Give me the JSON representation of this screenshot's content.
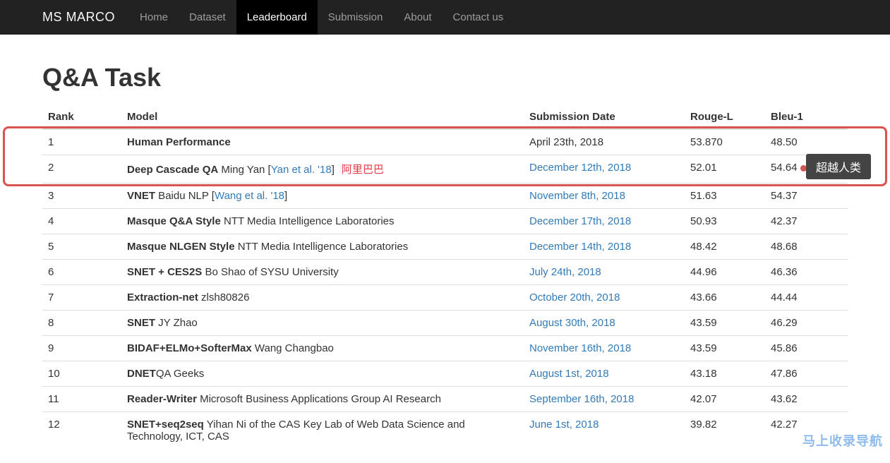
{
  "nav": {
    "brand": "MS MARCO",
    "items": [
      {
        "label": "Home",
        "active": false
      },
      {
        "label": "Dataset",
        "active": false
      },
      {
        "label": "Leaderboard",
        "active": true
      },
      {
        "label": "Submission",
        "active": false
      },
      {
        "label": "About",
        "active": false
      },
      {
        "label": "Contact us",
        "active": false
      }
    ]
  },
  "page": {
    "title": "Q&A Task"
  },
  "table": {
    "headers": {
      "rank": "Rank",
      "model": "Model",
      "date": "Submission Date",
      "rouge": "Rouge-L",
      "bleu": "Bleu-1"
    },
    "rows": [
      {
        "rank": "1",
        "model_strong": "Human Performance",
        "model_rest": "",
        "citation": "",
        "org_red": "",
        "date": "April 23th, 2018",
        "date_is_link": false,
        "rouge": "53.870",
        "bleu": "48.50",
        "bleu_dot": false
      },
      {
        "rank": "2",
        "model_strong": "Deep Cascade QA",
        "model_rest": " Ming Yan [",
        "citation": "Yan et al. '18",
        "citation_close": "]",
        "org_red": "阿里巴巴",
        "date": "December 12th, 2018",
        "date_is_link": true,
        "rouge": "52.01",
        "bleu": "54.64",
        "bleu_dot": true
      },
      {
        "rank": "3",
        "model_strong": "VNET",
        "model_rest": " Baidu NLP [",
        "citation": "Wang et al. '18",
        "citation_close": "]",
        "org_red": "",
        "date": "November 8th, 2018",
        "date_is_link": true,
        "rouge": "51.63",
        "bleu": "54.37",
        "bleu_dot": false
      },
      {
        "rank": "4",
        "model_strong": "Masque Q&A Style",
        "model_rest": " NTT Media Intelligence Laboratories",
        "citation": "",
        "org_red": "",
        "date": "December 17th, 2018",
        "date_is_link": true,
        "rouge": "50.93",
        "bleu": "42.37",
        "bleu_dot": false
      },
      {
        "rank": "5",
        "model_strong": "Masque NLGEN Style",
        "model_rest": " NTT Media Intelligence Laboratories",
        "citation": "",
        "org_red": "",
        "date": "December 14th, 2018",
        "date_is_link": true,
        "rouge": "48.42",
        "bleu": "48.68",
        "bleu_dot": false
      },
      {
        "rank": "6",
        "model_strong": "SNET + CES2S",
        "model_rest": " Bo Shao of SYSU University",
        "citation": "",
        "org_red": "",
        "date": "July 24th, 2018",
        "date_is_link": true,
        "rouge": "44.96",
        "bleu": "46.36",
        "bleu_dot": false
      },
      {
        "rank": "7",
        "model_strong": "Extraction-net",
        "model_rest": " zlsh80826",
        "citation": "",
        "org_red": "",
        "date": "October 20th, 2018",
        "date_is_link": true,
        "rouge": "43.66",
        "bleu": "44.44",
        "bleu_dot": false
      },
      {
        "rank": "8",
        "model_strong": "SNET",
        "model_rest": " JY Zhao",
        "citation": "",
        "org_red": "",
        "date": "August 30th, 2018",
        "date_is_link": true,
        "rouge": "43.59",
        "bleu": "46.29",
        "bleu_dot": false
      },
      {
        "rank": "9",
        "model_strong": "BIDAF+ELMo+SofterMax",
        "model_rest": " Wang Changbao",
        "citation": "",
        "org_red": "",
        "date": "November 16th, 2018",
        "date_is_link": true,
        "rouge": "43.59",
        "bleu": "45.86",
        "bleu_dot": false
      },
      {
        "rank": "10",
        "model_strong": "DNET",
        "model_rest": "QA Geeks",
        "citation": "",
        "org_red": "",
        "date": "August 1st, 2018",
        "date_is_link": true,
        "rouge": "43.18",
        "bleu": "47.86",
        "bleu_dot": false
      },
      {
        "rank": "11",
        "model_strong": "Reader-Writer",
        "model_rest": " Microsoft Business Applications Group AI Research",
        "citation": "",
        "org_red": "",
        "date": "September 16th, 2018",
        "date_is_link": true,
        "rouge": "42.07",
        "bleu": "43.62",
        "bleu_dot": false
      },
      {
        "rank": "12",
        "model_strong": "SNET+seq2seq",
        "model_rest": " Yihan Ni of the CAS Key Lab of Web Data Science and Technology, ICT, CAS",
        "citation": "",
        "org_red": "",
        "date": "June 1st, 2018",
        "date_is_link": true,
        "rouge": "39.82",
        "bleu": "42.27",
        "bleu_dot": false
      }
    ]
  },
  "annotations": {
    "surpass_badge": "超越人类",
    "watermark": "马上收录导航"
  }
}
